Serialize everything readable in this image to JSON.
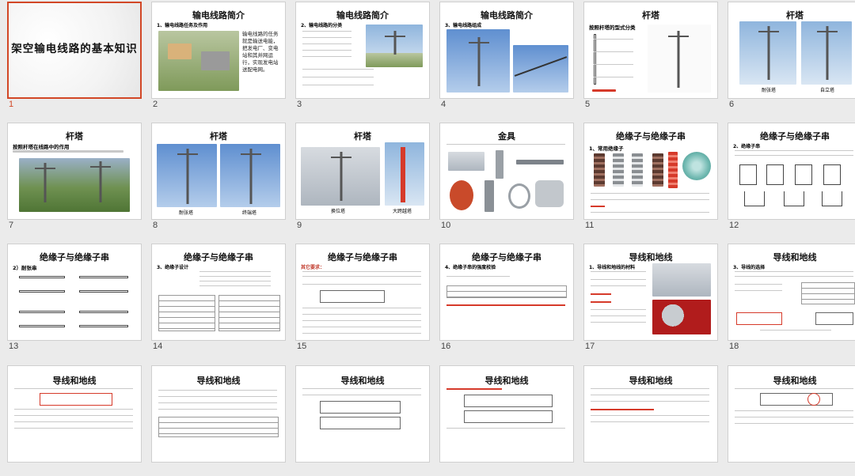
{
  "slides": [
    {
      "n": "1",
      "title": "架空输电线路的基本知识",
      "selected": true
    },
    {
      "n": "2",
      "title": "输电线路简介",
      "sub": "1、输电线路任务及作用",
      "text": "输电线路的任务就是输送电能，把发电厂、变电站和其并网运行，实现发电站送配电网。"
    },
    {
      "n": "3",
      "title": "输电线路简介",
      "sub": "2、输电线路的分类"
    },
    {
      "n": "4",
      "title": "输电线路简介",
      "sub": "3、输电线路组成"
    },
    {
      "n": "5",
      "title": "杆塔",
      "sub": "按照杆塔的型式分类"
    },
    {
      "n": "6",
      "title": "杆塔",
      "caps": [
        "耐张塔",
        "自立塔"
      ]
    },
    {
      "n": "7",
      "title": "杆塔",
      "sub": "按照杆塔在线路中的作用"
    },
    {
      "n": "8",
      "title": "杆塔",
      "caps": [
        "耐张塔",
        "终端塔"
      ]
    },
    {
      "n": "9",
      "title": "杆塔",
      "caps": [
        "换位塔",
        "大跨越塔"
      ]
    },
    {
      "n": "10",
      "title": "金具"
    },
    {
      "n": "11",
      "title": "绝缘子与绝缘子串",
      "sub": "1、常用绝缘子"
    },
    {
      "n": "12",
      "title": "绝缘子与绝缘子串",
      "sub": "2、绝缘子串"
    },
    {
      "n": "13",
      "title": "绝缘子与绝缘子串",
      "sub": "2）耐张串"
    },
    {
      "n": "14",
      "title": "绝缘子与绝缘子串",
      "sub": "3、绝缘子设计"
    },
    {
      "n": "15",
      "title": "绝缘子与绝缘子串",
      "sub": "其它要求："
    },
    {
      "n": "16",
      "title": "绝缘子与绝缘子串",
      "sub": "4、绝缘子串的强度校验"
    },
    {
      "n": "17",
      "title": "导线和地线",
      "sub": "1、导线和地线的材料"
    },
    {
      "n": "18",
      "title": "导线和地线",
      "sub": "3、导线的选择"
    },
    {
      "n": "19",
      "title": "导线和地线"
    },
    {
      "n": "20",
      "title": "导线和地线"
    },
    {
      "n": "21",
      "title": "导线和地线"
    },
    {
      "n": "22",
      "title": "导线和地线"
    },
    {
      "n": "23",
      "title": "导线和地线"
    },
    {
      "n": "24",
      "title": "导线和地线"
    }
  ],
  "colors": {
    "selection": "#d24726",
    "background": "#ebebeb",
    "slide": "#ffffff"
  }
}
